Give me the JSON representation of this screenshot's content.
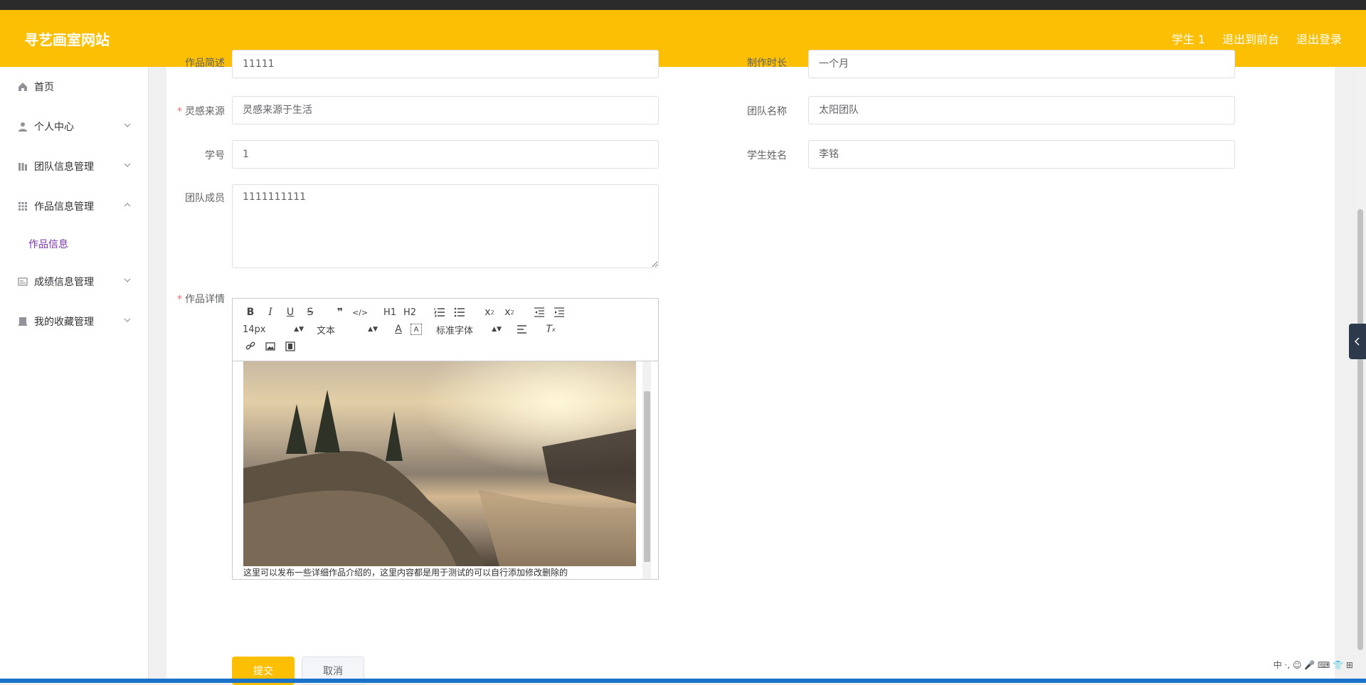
{
  "header": {
    "brand": "寻艺画室网站",
    "links": [
      "学生 1",
      "退出到前台",
      "退出登录"
    ]
  },
  "sidebar": {
    "items": [
      {
        "label": "首页",
        "icon": "home-icon"
      },
      {
        "label": "个人中心",
        "icon": "user-icon"
      },
      {
        "label": "团队信息管理",
        "icon": "team-icon"
      },
      {
        "label": "作品信息管理",
        "icon": "grid-icon"
      },
      {
        "label": "作品信息",
        "icon": ""
      },
      {
        "label": "成绩信息管理",
        "icon": "scores-icon"
      },
      {
        "label": "我的收藏管理",
        "icon": "collect-icon"
      }
    ]
  },
  "form": {
    "work_desc_label": "作品简述",
    "work_desc_value": "11111",
    "duration_label": "制作时长",
    "duration_value": "一个月",
    "inspiration_label": "灵感来源",
    "inspiration_value": "灵感来源于生活",
    "team_name_label": "团队名称",
    "team_name_value": "太阳团队",
    "student_id_label": "学号",
    "student_id_value": "1",
    "student_name_label": "学生姓名",
    "student_name_value": "李铭",
    "members_label": "团队成员",
    "members_value": "1111111111",
    "details_label": "作品详情"
  },
  "editor": {
    "font_size": "14px",
    "block_type": "文本",
    "font_family": "标准字体",
    "h1": "H1",
    "h2": "H2",
    "body_text": "这里可以发布一些详细作品介绍的，这里内容都是用于测试的可以自行添加修改删除的"
  },
  "actions": {
    "submit": "提交",
    "cancel": "取消"
  },
  "tray": {
    "text": "中 ·, ☺ 🎤 ⌨ 👕 ⊞"
  },
  "colors": {
    "primary": "#fdbf04",
    "active_submenu": "#7b34a9",
    "required": "#f56c6c"
  }
}
